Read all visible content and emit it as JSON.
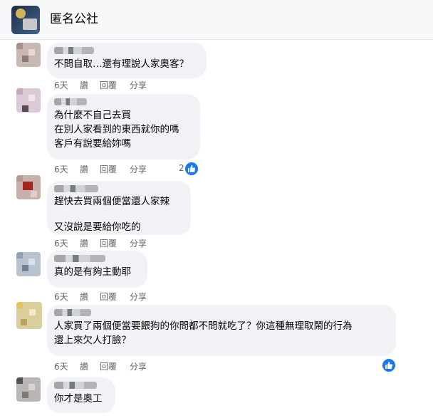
{
  "group": {
    "name": "匿名公社"
  },
  "comments": [
    {
      "text": "不問自取…還有理說人家奧客？",
      "actions": {
        "time": "6天",
        "like": "讚",
        "reply": "回覆",
        "share": "分享"
      }
    },
    {
      "text": "為什麼不自己去買\n在別人家看到的東西就你的嗎\n客戶有說要給妳嗎",
      "actions": {
        "time": "6天",
        "like": "讚",
        "reply": "回覆",
        "share": "分享"
      },
      "reactions": "2"
    },
    {
      "text": "趕快去買兩個便當還人家辣\n\n又沒說是要給你吃的",
      "actions": {
        "time": "6天",
        "like": "讚",
        "reply": "回覆",
        "share": "分享"
      }
    },
    {
      "text": "真的是有夠主動耶",
      "actions": {
        "time": "6天",
        "like": "讚",
        "reply": "回覆",
        "share": "分享"
      }
    },
    {
      "text": "人家買了兩個便當要餵狗的你問都不問就吃了？你這種無理取鬧的行為\n還上來欠人打臉？",
      "actions": {
        "time": "6天",
        "like": "讚",
        "reply": "回覆",
        "share": "分享"
      }
    },
    {
      "text": "你才是奧工"
    }
  ],
  "colors": {
    "accent": "#1877f2",
    "bubble": "#f0f2f5",
    "meta": "#65676b"
  }
}
